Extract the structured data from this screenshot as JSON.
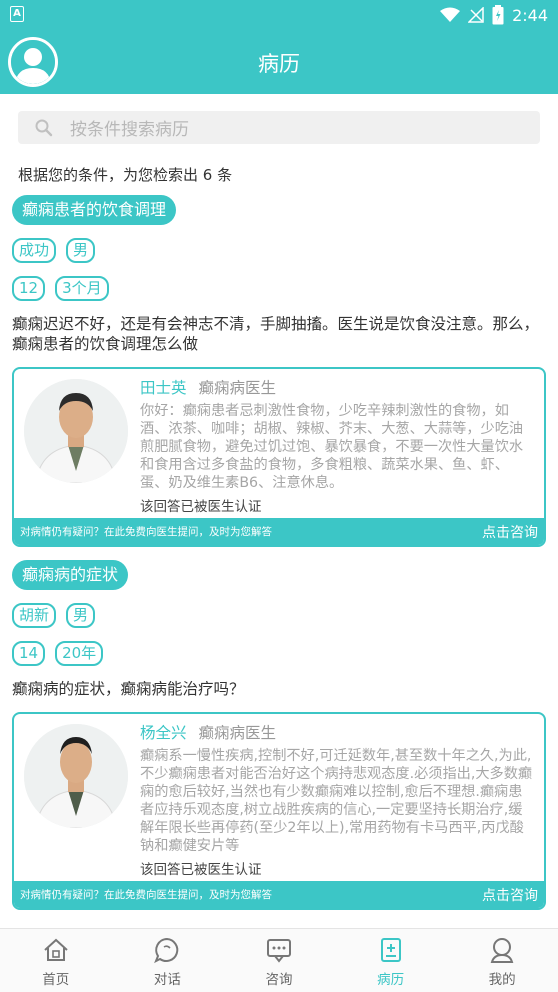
{
  "status_bar": {
    "notification_icon": "A",
    "time": "2:44"
  },
  "header": {
    "title": "病历",
    "avatar_icon": "user-avatar-icon"
  },
  "search": {
    "placeholder": "按条件搜索病历"
  },
  "result_summary": "根据您的条件，为您检索出 6 条",
  "records": [
    {
      "title": "癫痫患者的饮食调理",
      "tags_row1": [
        "成功",
        "男"
      ],
      "tags_row2": [
        "12",
        "3个月"
      ],
      "question": "癫痫迟迟不好，还是有会神志不清，手脚抽搐。医生说是饮食没注意。那么，癫痫患者的饮食调理怎么做",
      "doctor_name": "田士英",
      "doctor_dept": "癫痫病医生",
      "answer": "你好：癫痫患者忌刺激性食物，少吃辛辣刺激性的食物，如酒、浓茶、咖啡；胡椒、辣椒、芥末、大葱、大蒜等，少吃油煎肥腻食物，避免过饥过饱、暴饮暴食，不要一次性大量饮水和食用含过多食盐的食物，多食粗粮、蔬菜水果、鱼、虾、蛋、奶及维生素B6、注意休息。",
      "verified": "该回答已被医生认证",
      "footer_text": "对病情仍有疑问？在此免费向医生提问，及时为您解答",
      "consult": "点击咨询"
    },
    {
      "title": "癫痫病的症状",
      "tags_row1": [
        "胡新",
        "男"
      ],
      "tags_row2": [
        "14",
        "20年"
      ],
      "question": "癫痫病的症状，癫痫病能治疗吗？",
      "doctor_name": "杨全兴",
      "doctor_dept": "癫痫病医生",
      "answer": "癫痫系一慢性疾病,控制不好,可迁延数年,甚至数十年之久,为此,不少癫痫患者对能否治好这个病持悲观态度.必须指出,大多数癫痫的愈后较好,当然也有少数癫痫难以控制,愈后不理想.癫痫患者应持乐观态度,树立战胜疾病的信心,一定要坚持长期治疗,缓解年限长些再停药(至少2年以上),常用药物有卡马西平,丙戊酸钠和癫健安片等",
      "verified": "该回答已被医生认证",
      "footer_text": "对病情仍有疑问？在此免费向医生提问，及时为您解答",
      "consult": "点击咨询"
    }
  ],
  "tabs": [
    {
      "label": "首页",
      "icon": "home-icon",
      "active": false
    },
    {
      "label": "对话",
      "icon": "chat-bubble-icon",
      "active": false
    },
    {
      "label": "咨询",
      "icon": "consult-icon",
      "active": false
    },
    {
      "label": "病历",
      "icon": "medical-record-icon",
      "active": true
    },
    {
      "label": "我的",
      "icon": "profile-icon",
      "active": false
    }
  ],
  "colors": {
    "accent": "#3cc6c6",
    "muted_text": "#a6a6a6"
  }
}
